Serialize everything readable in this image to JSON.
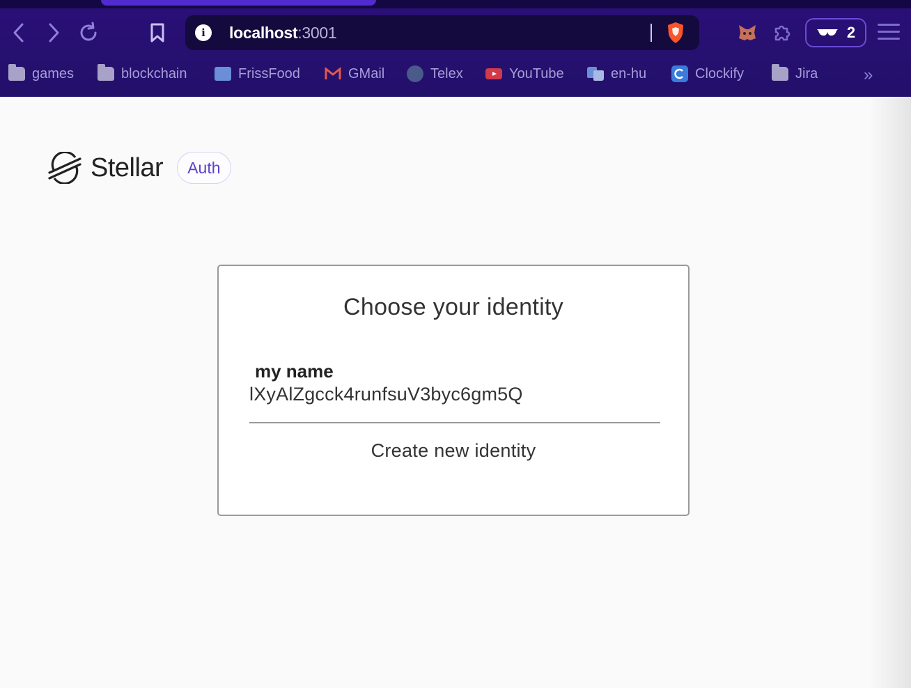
{
  "browser": {
    "url_host": "localhost",
    "url_port": ":3001",
    "wallet_count": "2",
    "bookmarks": [
      {
        "label": "games",
        "icon": "folder-icon"
      },
      {
        "label": "blockchain",
        "icon": "folder-icon"
      },
      {
        "label": "FrissFood",
        "icon": "frissfood-icon"
      },
      {
        "label": "GMail",
        "icon": "gmail-icon"
      },
      {
        "label": "Telex",
        "icon": "telex-icon"
      },
      {
        "label": "YouTube",
        "icon": "youtube-icon"
      },
      {
        "label": "en-hu",
        "icon": "translate-icon"
      },
      {
        "label": "Clockify",
        "icon": "clockify-icon"
      },
      {
        "label": "Jira",
        "icon": "folder-icon"
      }
    ],
    "more": "»"
  },
  "header": {
    "brand": "Stellar",
    "badge": "Auth"
  },
  "card": {
    "title": "Choose your identity",
    "identities": [
      {
        "name": "my name",
        "key": "lXyAlZgcck4runfsuV3byc6gm5Q"
      }
    ],
    "create_label": "Create new identity"
  },
  "colors": {
    "chrome_bg": "#2a0f78",
    "accent": "#5e43c8"
  }
}
